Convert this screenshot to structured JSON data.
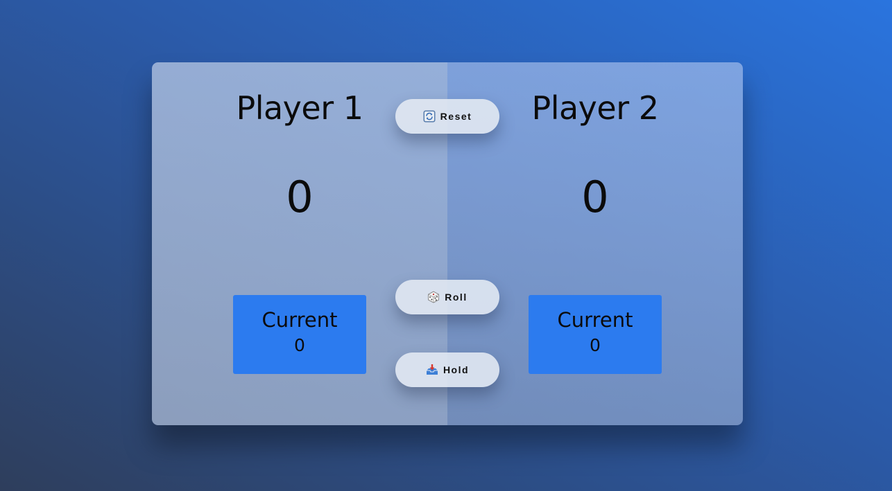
{
  "players": [
    {
      "name": "Player 1",
      "score": "0",
      "current_label": "Current",
      "current_score": "0"
    },
    {
      "name": "Player 2",
      "score": "0",
      "current_label": "Current",
      "current_score": "0"
    }
  ],
  "buttons": {
    "reset": {
      "label": "Reset",
      "icon": "reset-arrows-icon"
    },
    "roll": {
      "label": "Roll",
      "icon": "dice-icon"
    },
    "hold": {
      "label": "Hold",
      "icon": "inbox-tray-icon"
    }
  },
  "colors": {
    "current_box": "#2c7bef",
    "background_start": "#2e3e5c",
    "background_end": "#2a74de"
  }
}
